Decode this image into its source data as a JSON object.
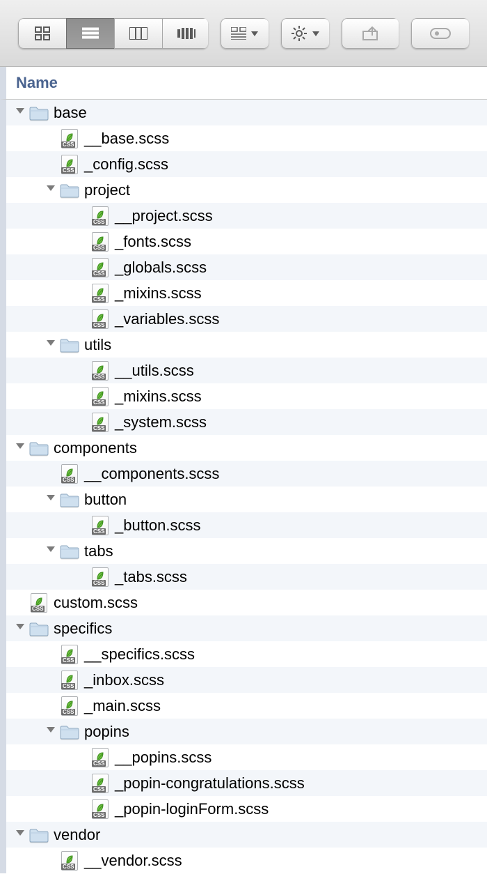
{
  "column_header": "Name",
  "toolbar": {
    "view_icon_active_index": 1
  },
  "tree": [
    {
      "depth": 0,
      "type": "folder",
      "expanded": true,
      "name": "base"
    },
    {
      "depth": 1,
      "type": "file",
      "name": "__base.scss"
    },
    {
      "depth": 1,
      "type": "file",
      "name": "_config.scss"
    },
    {
      "depth": 1,
      "type": "folder",
      "expanded": true,
      "name": "project"
    },
    {
      "depth": 2,
      "type": "file",
      "name": "__project.scss"
    },
    {
      "depth": 2,
      "type": "file",
      "name": "_fonts.scss"
    },
    {
      "depth": 2,
      "type": "file",
      "name": "_globals.scss"
    },
    {
      "depth": 2,
      "type": "file",
      "name": "_mixins.scss"
    },
    {
      "depth": 2,
      "type": "file",
      "name": "_variables.scss"
    },
    {
      "depth": 1,
      "type": "folder",
      "expanded": true,
      "name": "utils"
    },
    {
      "depth": 2,
      "type": "file",
      "name": "__utils.scss"
    },
    {
      "depth": 2,
      "type": "file",
      "name": "_mixins.scss"
    },
    {
      "depth": 2,
      "type": "file",
      "name": "_system.scss"
    },
    {
      "depth": 0,
      "type": "folder",
      "expanded": true,
      "name": "components"
    },
    {
      "depth": 1,
      "type": "file",
      "name": "__components.scss"
    },
    {
      "depth": 1,
      "type": "folder",
      "expanded": true,
      "name": "button"
    },
    {
      "depth": 2,
      "type": "file",
      "name": "_button.scss"
    },
    {
      "depth": 1,
      "type": "folder",
      "expanded": true,
      "name": "tabs"
    },
    {
      "depth": 2,
      "type": "file",
      "name": "_tabs.scss"
    },
    {
      "depth": 0,
      "type": "file",
      "name": "custom.scss"
    },
    {
      "depth": 0,
      "type": "folder",
      "expanded": true,
      "name": "specifics"
    },
    {
      "depth": 1,
      "type": "file",
      "name": "__specifics.scss"
    },
    {
      "depth": 1,
      "type": "file",
      "name": "_inbox.scss"
    },
    {
      "depth": 1,
      "type": "file",
      "name": "_main.scss"
    },
    {
      "depth": 1,
      "type": "folder",
      "expanded": true,
      "name": "popins"
    },
    {
      "depth": 2,
      "type": "file",
      "name": "__popins.scss"
    },
    {
      "depth": 2,
      "type": "file",
      "name": "_popin-congratulations.scss"
    },
    {
      "depth": 2,
      "type": "file",
      "name": "_popin-loginForm.scss"
    },
    {
      "depth": 0,
      "type": "folder",
      "expanded": true,
      "name": "vendor"
    },
    {
      "depth": 1,
      "type": "file",
      "name": "__vendor.scss"
    }
  ]
}
